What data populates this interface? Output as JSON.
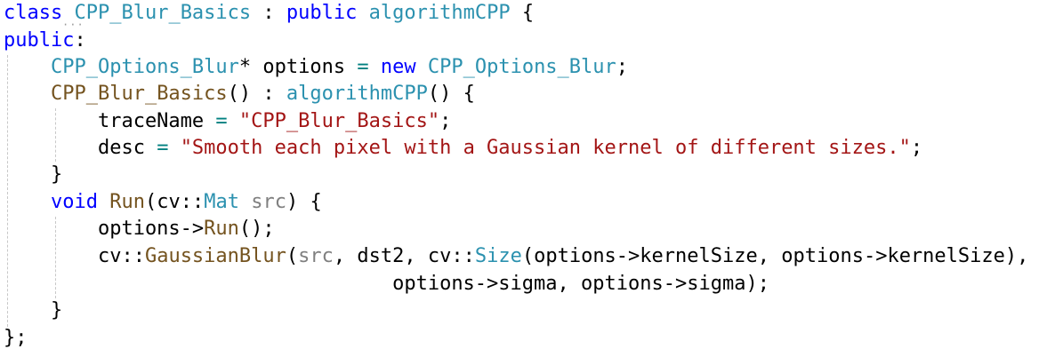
{
  "theme": {
    "keyword": "#0000ff",
    "class_name": "#2b91af",
    "function": "#74531f",
    "string": "#a31515",
    "operator": "#008080",
    "text": "#000000",
    "param": "#808080"
  },
  "editor": {
    "lines": [
      [
        {
          "t": "class",
          "k": "keyword"
        },
        {
          "t": " ",
          "k": "text"
        },
        {
          "t": "CPP_Blur_Basics",
          "k": "class_name"
        },
        {
          "t": " : ",
          "k": "text"
        },
        {
          "t": "public",
          "k": "keyword"
        },
        {
          "t": " ",
          "k": "text"
        },
        {
          "t": "algorithmCPP",
          "k": "class_name"
        },
        {
          "t": " {",
          "k": "text"
        }
      ],
      [
        {
          "t": "public",
          "k": "keyword"
        },
        {
          "t": ":",
          "k": "text"
        }
      ],
      [
        {
          "t": "    ",
          "k": "text"
        },
        {
          "t": "CPP_Options_Blur",
          "k": "class_name"
        },
        {
          "t": "* options ",
          "k": "text"
        },
        {
          "t": "=",
          "k": "operator"
        },
        {
          "t": " ",
          "k": "text"
        },
        {
          "t": "new",
          "k": "keyword"
        },
        {
          "t": " ",
          "k": "text"
        },
        {
          "t": "CPP_Options_Blur",
          "k": "class_name"
        },
        {
          "t": ";",
          "k": "text"
        }
      ],
      [
        {
          "t": "    ",
          "k": "text"
        },
        {
          "t": "CPP_Blur_Basics",
          "k": "function"
        },
        {
          "t": "() : ",
          "k": "text"
        },
        {
          "t": "algorithmCPP",
          "k": "class_name"
        },
        {
          "t": "() {",
          "k": "text"
        }
      ],
      [
        {
          "t": "        traceName ",
          "k": "text"
        },
        {
          "t": "=",
          "k": "operator"
        },
        {
          "t": " ",
          "k": "text"
        },
        {
          "t": "\"CPP_Blur_Basics\"",
          "k": "string"
        },
        {
          "t": ";",
          "k": "text"
        }
      ],
      [
        {
          "t": "        desc ",
          "k": "text"
        },
        {
          "t": "=",
          "k": "operator"
        },
        {
          "t": " ",
          "k": "text"
        },
        {
          "t": "\"Smooth each pixel with a Gaussian kernel of different sizes.\"",
          "k": "string"
        },
        {
          "t": ";",
          "k": "text"
        }
      ],
      [
        {
          "t": "    }",
          "k": "text"
        }
      ],
      [
        {
          "t": "    ",
          "k": "text"
        },
        {
          "t": "void",
          "k": "keyword"
        },
        {
          "t": " ",
          "k": "text"
        },
        {
          "t": "Run",
          "k": "function"
        },
        {
          "t": "(cv::",
          "k": "text"
        },
        {
          "t": "Mat",
          "k": "class_name"
        },
        {
          "t": " ",
          "k": "text"
        },
        {
          "t": "src",
          "k": "param"
        },
        {
          "t": ") {",
          "k": "text"
        }
      ],
      [
        {
          "t": "        options->",
          "k": "text"
        },
        {
          "t": "Run",
          "k": "function"
        },
        {
          "t": "();",
          "k": "text"
        }
      ],
      [
        {
          "t": "        cv::",
          "k": "text"
        },
        {
          "t": "GaussianBlur",
          "k": "function"
        },
        {
          "t": "(",
          "k": "text"
        },
        {
          "t": "src",
          "k": "param"
        },
        {
          "t": ", dst2, cv::",
          "k": "text"
        },
        {
          "t": "Size",
          "k": "class_name"
        },
        {
          "t": "(options->kernelSize, options->kernelSize),",
          "k": "text"
        }
      ],
      [
        {
          "t": "                                 options->sigma, options->sigma);",
          "k": "text"
        }
      ],
      [
        {
          "t": "    }",
          "k": "text"
        }
      ],
      [
        {
          "t": "};",
          "k": "text"
        }
      ]
    ]
  }
}
